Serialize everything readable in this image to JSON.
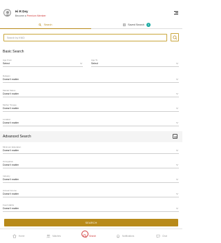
{
  "header": {
    "greeting": "Hi R Dey",
    "premium_prefix": "Become a ",
    "premium_link": "Premium Member"
  },
  "tabs": [
    {
      "label": "Search",
      "active": true
    },
    {
      "label": "Saved Search",
      "badge": "0",
      "active": false
    }
  ],
  "search": {
    "placeholder": "Search by KNID"
  },
  "basic_search": {
    "title": "Basic Search",
    "age_from": {
      "label": "Age From",
      "value": "Select"
    },
    "age_to": {
      "label": "Age To",
      "value": "Select"
    },
    "fields": [
      {
        "label": "Religion",
        "value": "Doesn't matter"
      },
      {
        "label": "Marital Status",
        "value": "Doesn't matter"
      },
      {
        "label": "Mother Tongue",
        "value": "Doesn't matter"
      },
      {
        "label": "Location",
        "value": "Doesn't matter"
      }
    ]
  },
  "advanced_search": {
    "title": "Advanced Search",
    "fields": [
      {
        "label": "Minimum Education",
        "value": "Doesn't matter"
      },
      {
        "label": "Occupation",
        "value": "Doesn't matter"
      },
      {
        "label": "Industry",
        "value": "Doesn't matter"
      },
      {
        "label": "Annual Income",
        "value": "Doesn't matter"
      },
      {
        "label": "Food Habits",
        "value": "Doesn't matter"
      }
    ]
  },
  "submit_label": "SEARCH",
  "bottom_nav": [
    {
      "label": "Home",
      "icon": "home-icon"
    },
    {
      "label": "Matches",
      "icon": "matches-icon"
    },
    {
      "label": "Search",
      "icon": "search-icon",
      "active": true
    },
    {
      "label": "Notifications",
      "icon": "bell-icon"
    },
    {
      "label": "Chat",
      "icon": "chat-icon"
    }
  ],
  "colors": {
    "accent": "#b88a1a",
    "highlight": "#d13b3b",
    "badge": "#17a9a1"
  }
}
